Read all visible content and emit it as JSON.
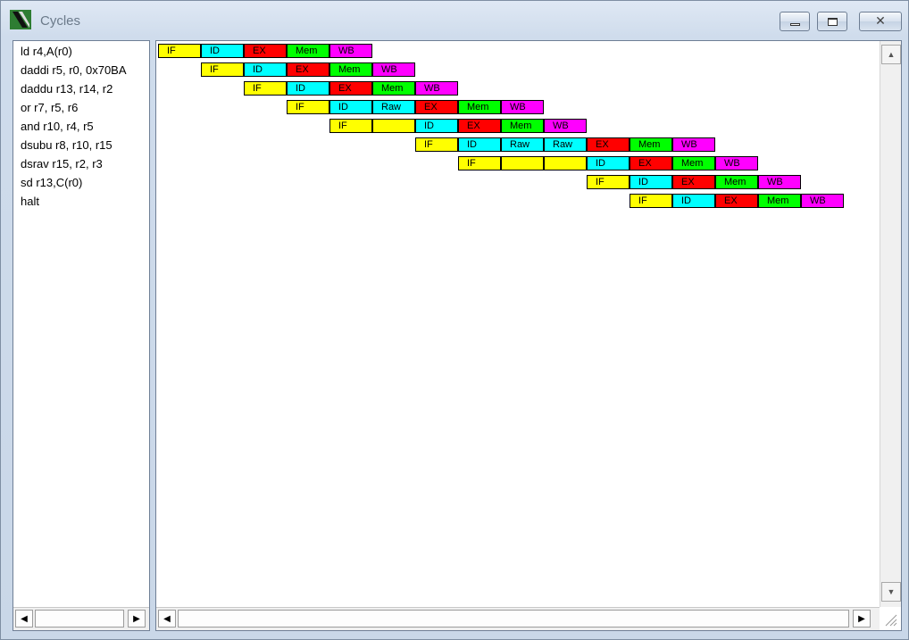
{
  "window": {
    "title": "Cycles"
  },
  "colors": {
    "IF": "#ffff00",
    "ID": "#00ffff",
    "EX": "#ff0000",
    "Mem": "#00ff00",
    "WB": "#ff00ff",
    "Raw": "#00ffff",
    "stall": "#ffff00"
  },
  "instructions": [
    "ld r4,A(r0)",
    "daddi r5, r0, 0x70BA",
    "daddu r13, r14, r2",
    "or r7, r5, r6",
    "and r10, r4, r5",
    "dsubu r8, r10, r15",
    "dsrav r15, r2, r3",
    "sd r13,C(r0)",
    "halt"
  ],
  "pipeline": [
    {
      "start": 0,
      "stages": [
        "IF",
        "ID",
        "EX",
        "Mem",
        "WB"
      ]
    },
    {
      "start": 1,
      "stages": [
        "IF",
        "ID",
        "EX",
        "Mem",
        "WB"
      ]
    },
    {
      "start": 2,
      "stages": [
        "IF",
        "ID",
        "EX",
        "Mem",
        "WB"
      ]
    },
    {
      "start": 3,
      "stages": [
        "IF",
        "ID",
        "Raw",
        "EX",
        "Mem",
        "WB"
      ]
    },
    {
      "start": 4,
      "stages": [
        "IF",
        "",
        "ID",
        "EX",
        "Mem",
        "WB"
      ]
    },
    {
      "start": 6,
      "stages": [
        "IF",
        "ID",
        "Raw",
        "Raw",
        "EX",
        "Mem",
        "WB"
      ]
    },
    {
      "start": 7,
      "stages": [
        "IF",
        "",
        "",
        "ID",
        "EX",
        "Mem",
        "WB"
      ]
    },
    {
      "start": 10,
      "stages": [
        "IF",
        "ID",
        "EX",
        "Mem",
        "WB"
      ]
    },
    {
      "start": 11,
      "stages": [
        "IF",
        "ID",
        "EX",
        "Mem",
        "WB"
      ]
    }
  ]
}
